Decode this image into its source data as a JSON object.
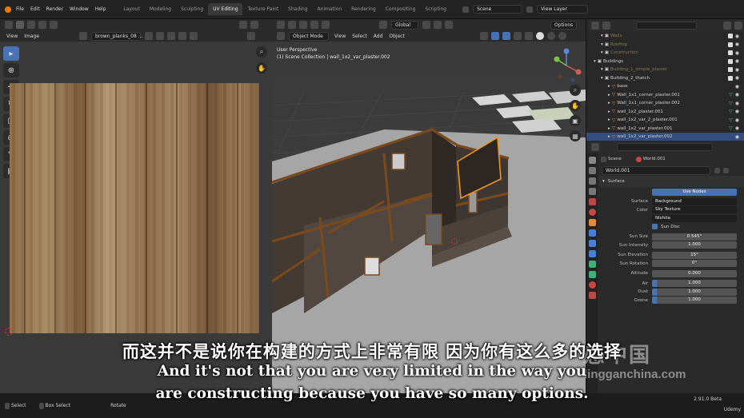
{
  "topbar": {
    "menus": [
      "File",
      "Edit",
      "Render",
      "Window",
      "Help"
    ],
    "workspaces": [
      "Layout",
      "Modeling",
      "Sculpting",
      "UV Editing",
      "Texture Paint",
      "Shading",
      "Animation",
      "Rendering",
      "Compositing",
      "Scripting"
    ],
    "active_workspace": "UV Editing",
    "scene": "Scene",
    "view_layer": "View Layer"
  },
  "uv_editor": {
    "menus": [
      "View",
      "Image"
    ],
    "image_name": "brown_planks_08 ..."
  },
  "viewport": {
    "mode": "Object Mode",
    "menus": [
      "View",
      "Select",
      "Add",
      "Object"
    ],
    "transform": "Global",
    "options": "Options",
    "perspective": "User Perspective",
    "collection_path": "(1) Scene Collection | wall_1x2_var_plaster.002"
  },
  "outliner": {
    "items": [
      {
        "name": "Walls",
        "indent": 2,
        "selected": false,
        "mod": false
      },
      {
        "name": "Roofing",
        "indent": 2,
        "selected": false,
        "mod": false
      },
      {
        "name": "Construction",
        "indent": 2,
        "selected": false,
        "mod": false
      },
      {
        "name": "Buildings",
        "indent": 1,
        "selected": false,
        "mod": false
      },
      {
        "name": "Building_1_simple_plaster",
        "indent": 2,
        "selected": false,
        "mod": false
      },
      {
        "name": "Building_2_thatch",
        "indent": 2,
        "selected": false,
        "mod": false
      },
      {
        "name": "base",
        "indent": 3,
        "selected": false,
        "mod": false
      },
      {
        "name": "Wall_1x1_corner_plaster.001",
        "indent": 3,
        "selected": false,
        "mod": true
      },
      {
        "name": "Wall_1x1_corner_plaster.002",
        "indent": 3,
        "selected": false,
        "mod": true
      },
      {
        "name": "wall_1x2_plaster.001",
        "indent": 3,
        "selected": false,
        "mod": true
      },
      {
        "name": "wall_1x2_var_2_plaster.001",
        "indent": 3,
        "selected": false,
        "mod": true
      },
      {
        "name": "wall_1x2_var_plaster.001",
        "indent": 3,
        "selected": false,
        "mod": true
      },
      {
        "name": "wall_1x2_var_plaster.002",
        "indent": 3,
        "selected": true,
        "mod": false
      }
    ]
  },
  "properties": {
    "breadcrumb_scene": "Scene",
    "breadcrumb_world": "World.001",
    "world_name": "World.001",
    "surface_panel": "Surface",
    "use_nodes": "Use Nodes",
    "rows": [
      {
        "label": "Surface",
        "value": "Background",
        "style": "dark"
      },
      {
        "label": "Color",
        "value": "Sky Texture",
        "style": "dark"
      },
      {
        "label": "",
        "value": "Nishita",
        "style": "dark"
      },
      {
        "label": "",
        "value": "Sun Disc",
        "style": "check"
      },
      {
        "label": "Sun Size",
        "value": "0.545°",
        "style": "plain"
      },
      {
        "label": "Sun Intensity",
        "value": "1.000",
        "style": "plain"
      },
      {
        "label": "Sun Elevation",
        "value": "15°",
        "style": "plain"
      },
      {
        "label": "Sun Rotation",
        "value": "0°",
        "style": "plain"
      },
      {
        "label": "Altitude",
        "value": "0.000",
        "style": "plain"
      },
      {
        "label": "Air",
        "value": "1.000",
        "style": "blue"
      },
      {
        "label": "Dust",
        "value": "1.000",
        "style": "blue"
      },
      {
        "label": "Ozone",
        "value": "1.000",
        "style": "blue"
      }
    ]
  },
  "status": {
    "left_1": "Select",
    "left_2": "Box Select",
    "left_3": "Rotate",
    "version": "2.91.0 Beta",
    "brand": "Udemy"
  },
  "subtitles": {
    "chinese": "而这并不是说你在构建的方式上非常有限 因为你有这么多的选择",
    "english_line1": "And it's not that you are very limited in the way you",
    "english_line2": "are constructing because you have so many options."
  },
  "watermark": {
    "logo": "感中国",
    "url": "lingganchina.com"
  }
}
